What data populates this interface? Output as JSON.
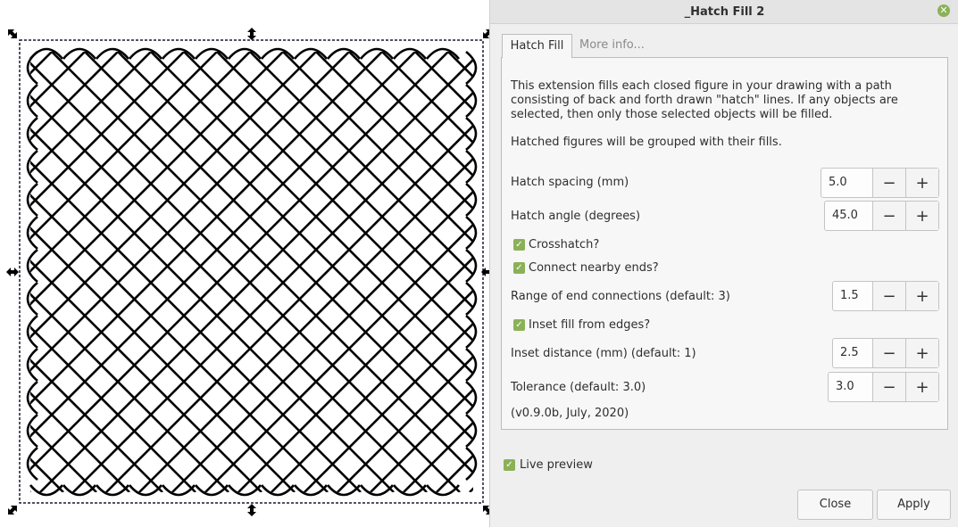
{
  "dialog": {
    "title": "_Hatch Fill 2",
    "tabs": [
      "Hatch Fill",
      "More info..."
    ],
    "description": "This extension fills each closed figure in your drawing with a path consisting of back and forth drawn \"hatch\" lines. If any objects are selected, then only those selected objects will be filled.",
    "grouping_note": "Hatched figures will be grouped with their fills.",
    "hatch_spacing": {
      "label": "Hatch spacing (mm)",
      "value": "5.0"
    },
    "hatch_angle": {
      "label": "Hatch angle (degrees)",
      "value": "45.0"
    },
    "crosshatch": {
      "label": "Crosshatch?",
      "checked": true
    },
    "connect_ends": {
      "label": "Connect nearby ends?",
      "checked": true
    },
    "end_range": {
      "label": "Range of end connections (default: 3)",
      "value": "1.5"
    },
    "inset_fill": {
      "label": "Inset fill from edges?",
      "checked": true
    },
    "inset_distance": {
      "label": "Inset distance (mm) (default: 1)",
      "value": "2.5"
    },
    "tolerance": {
      "label": "Tolerance (default: 3.0)",
      "value": "3.0"
    },
    "version": "(v0.9.0b, July, 2020)",
    "live_preview": {
      "label": "Live preview",
      "checked": true
    },
    "close_label": "Close",
    "apply_label": "Apply",
    "minus_glyph": "−",
    "plus_glyph": "+",
    "check_glyph": "✓",
    "close_glyph": "✕"
  },
  "colors": {
    "accent_green": "#8bb158",
    "hatch_stroke": "#000000"
  }
}
